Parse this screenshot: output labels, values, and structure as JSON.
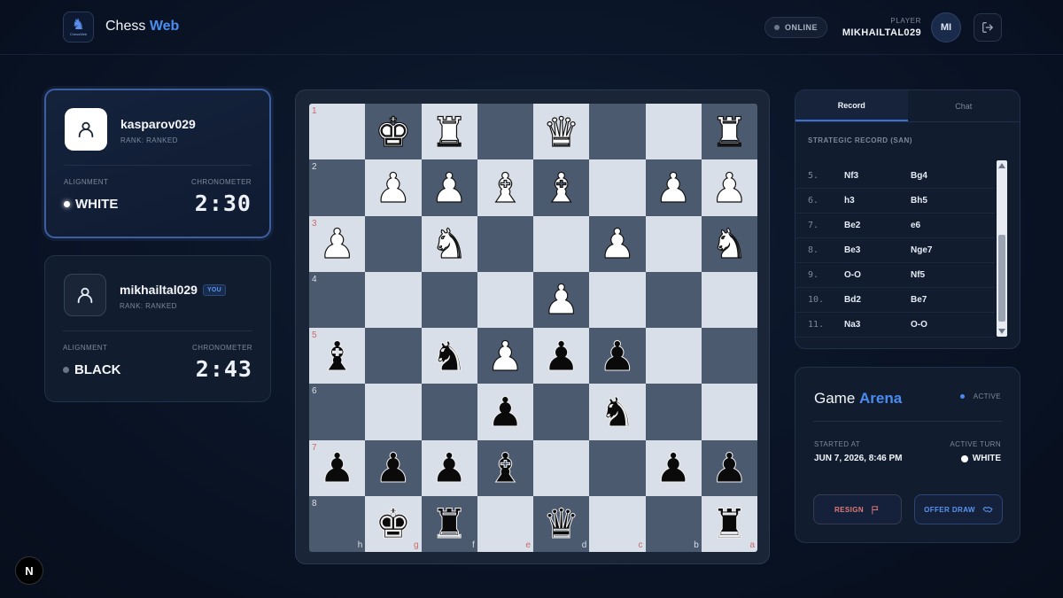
{
  "header": {
    "logo_text": "ChessWeb",
    "brand_main": "Chess",
    "brand_accent": "Web",
    "status": "ONLINE",
    "player_label": "PLAYER",
    "player_name": "MIKHAILTAL029",
    "avatar_initials": "MI"
  },
  "players": [
    {
      "name": "kasparov029",
      "rank": "RANK: RANKED",
      "alignment_label": "ALIGNMENT",
      "chronometer_label": "CHRONOMETER",
      "alignment": "WHITE",
      "time": "2:30",
      "active": true
    },
    {
      "name": "mikhailtal029",
      "badge": "YOU",
      "rank": "RANK: RANKED",
      "alignment_label": "ALIGNMENT",
      "chronometer_label": "CHRONOMETER",
      "alignment": "BLACK",
      "time": "2:43",
      "active": false
    }
  ],
  "board": {
    "rank_labels": [
      "1",
      "2",
      "3",
      "4",
      "5",
      "6",
      "7",
      "8"
    ],
    "file_labels": [
      "h",
      "g",
      "f",
      "e",
      "d",
      "c",
      "b",
      "a"
    ],
    "rows": [
      [
        "",
        "wK",
        "wR",
        "",
        "wQ",
        "",
        "",
        "wR"
      ],
      [
        "",
        "wP",
        "wP",
        "wB",
        "wB",
        "",
        "wP",
        "wP"
      ],
      [
        "wP",
        "",
        "wN",
        "",
        "",
        "wP",
        "",
        "wN"
      ],
      [
        "",
        "",
        "",
        "",
        "wP",
        "",
        "",
        ""
      ],
      [
        "bB",
        "",
        "bN",
        "wP",
        "bP",
        "bP",
        "",
        ""
      ],
      [
        "",
        "",
        "",
        "bP",
        "",
        "bN",
        "",
        ""
      ],
      [
        "bP",
        "bP",
        "bP",
        "bB",
        "",
        "",
        "bP",
        "bP"
      ],
      [
        "",
        "bK",
        "bR",
        "",
        "bQ",
        "",
        "",
        "bR"
      ]
    ]
  },
  "record": {
    "tabs": [
      "Record",
      "Chat"
    ],
    "active_tab": "Record",
    "title": "STRATEGIC RECORD (SAN)",
    "moves": [
      {
        "n": "5.",
        "w": "Nf3",
        "b": "Bg4"
      },
      {
        "n": "6.",
        "w": "h3",
        "b": "Bh5"
      },
      {
        "n": "7.",
        "w": "Be2",
        "b": "e6"
      },
      {
        "n": "8.",
        "w": "Be3",
        "b": "Nge7"
      },
      {
        "n": "9.",
        "w": "O-O",
        "b": "Nf5"
      },
      {
        "n": "10.",
        "w": "Bd2",
        "b": "Be7"
      },
      {
        "n": "11.",
        "w": "Na3",
        "b": "O-O"
      }
    ]
  },
  "arena": {
    "title_main": "Game",
    "title_accent": "Arena",
    "status": "ACTIVE",
    "started_label": "STARTED AT",
    "started_value": "JUN 7, 2026, 8:46 PM",
    "turn_label": "ACTIVE TURN",
    "turn_value": "WHITE",
    "resign_label": "RESIGN",
    "draw_label": "OFFER DRAW"
  },
  "corner_badge": "N"
}
